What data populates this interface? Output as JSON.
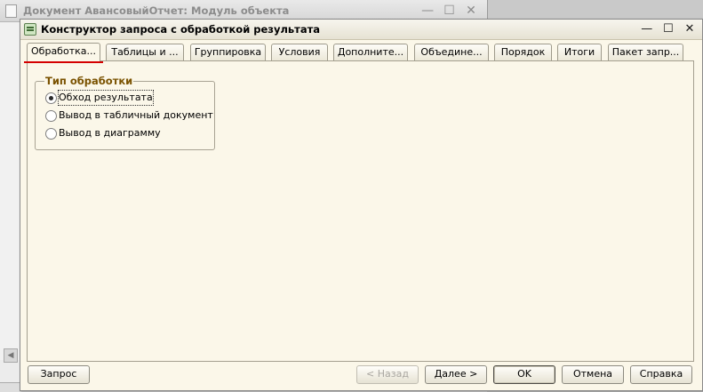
{
  "background_window": {
    "title": "Документ АвансовыйОтчет: Модуль объекта",
    "controls": {
      "minimize": "—",
      "maximize": "☐",
      "close": "✕"
    },
    "scroll_arrow": "◀"
  },
  "dialog": {
    "title": "Конструктор запроса с обработкой результата",
    "controls": {
      "minimize": "—",
      "maximize": "☐",
      "close": "✕"
    },
    "tabs": [
      {
        "label": "Обработка...",
        "active": true
      },
      {
        "label": "Таблицы и ..."
      },
      {
        "label": "Группировка"
      },
      {
        "label": "Условия"
      },
      {
        "label": "Дополните..."
      },
      {
        "label": "Объедине..."
      },
      {
        "label": "Порядок"
      },
      {
        "label": "Итоги"
      },
      {
        "label": "Пакет запр..."
      }
    ],
    "processing_group": {
      "legend": "Тип обработки",
      "options": [
        {
          "label": "Обход результата",
          "selected": true
        },
        {
          "label": "Вывод в табличный документ",
          "selected": false
        },
        {
          "label": "Вывод в диаграмму",
          "selected": false
        }
      ]
    },
    "buttons": {
      "query": "Запрос",
      "back": "< Назад",
      "next": "Далее >",
      "ok": "OK",
      "cancel": "Отмена",
      "help": "Справка"
    }
  },
  "colors": {
    "dialog_bg": "#fbf7e9",
    "group_legend": "#7a5200",
    "active_tab_underline": "#d40000"
  }
}
